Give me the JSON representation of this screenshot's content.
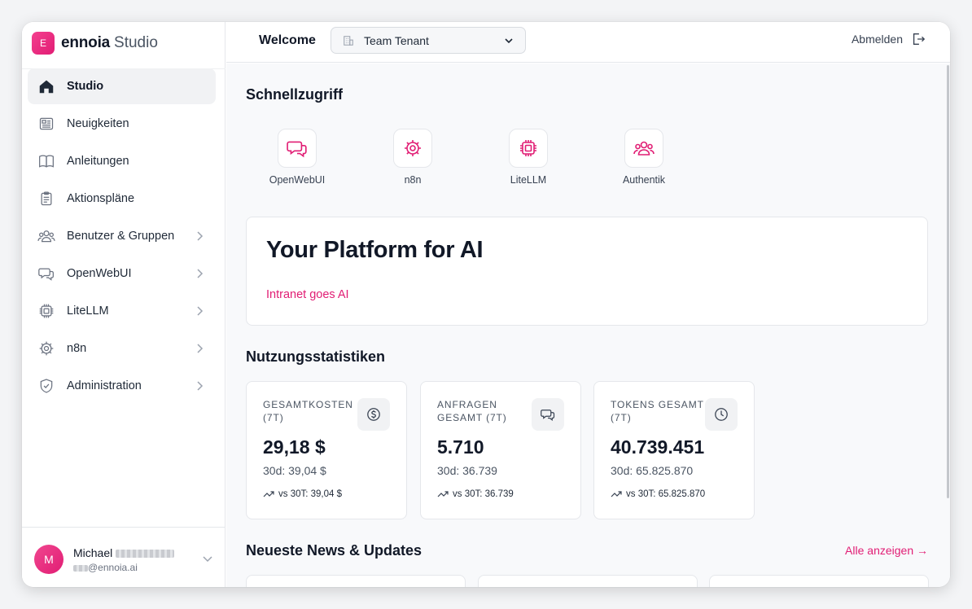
{
  "brand": {
    "badge": "E",
    "name": "ennoia",
    "suffix": "Studio",
    "accent": "#e11d74"
  },
  "sidebar": {
    "items": [
      {
        "label": "Studio",
        "icon": "home-icon",
        "active": true,
        "expandable": false
      },
      {
        "label": "Neuigkeiten",
        "icon": "newspaper-icon",
        "active": false,
        "expandable": false
      },
      {
        "label": "Anleitungen",
        "icon": "book-icon",
        "active": false,
        "expandable": false
      },
      {
        "label": "Aktionspläne",
        "icon": "clipboard-icon",
        "active": false,
        "expandable": false
      },
      {
        "label": "Benutzer & Gruppen",
        "icon": "users-icon",
        "active": false,
        "expandable": true
      },
      {
        "label": "OpenWebUI",
        "icon": "chat-icon",
        "active": false,
        "expandable": true
      },
      {
        "label": "LiteLLM",
        "icon": "chip-icon",
        "active": false,
        "expandable": true
      },
      {
        "label": "n8n",
        "icon": "cog-icon",
        "active": false,
        "expandable": true
      },
      {
        "label": "Administration",
        "icon": "shield-icon",
        "active": false,
        "expandable": true
      }
    ]
  },
  "user": {
    "initial": "M",
    "name": "Michael",
    "email": "@ennoia.ai"
  },
  "topbar": {
    "welcome": "Welcome",
    "tenant": "Team Tenant",
    "logout": "Abmelden"
  },
  "quick_access": {
    "title": "Schnellzugriff",
    "items": [
      {
        "label": "OpenWebUI",
        "icon": "chat-icon"
      },
      {
        "label": "n8n",
        "icon": "cog-icon"
      },
      {
        "label": "LiteLLM",
        "icon": "chip-icon"
      },
      {
        "label": "Authentik",
        "icon": "users-icon"
      }
    ]
  },
  "hero": {
    "title": "Your Platform for AI",
    "subtitle": "Intranet goes AI"
  },
  "stats": {
    "title": "Nutzungsstatistiken",
    "cards": [
      {
        "label": "GESAMTKOSTEN (7T)",
        "icon": "dollar-icon",
        "value": "29,18 $",
        "d30": "30d: 39,04 $",
        "vs": "vs 30T: 39,04 $"
      },
      {
        "label": "ANFRAGEN GESAMT (7T)",
        "icon": "chat-icon",
        "value": "5.710",
        "d30": "30d: 36.739",
        "vs": "vs 30T: 36.739"
      },
      {
        "label": "TOKENS GESAMT (7T)",
        "icon": "clock-icon",
        "value": "40.739.451",
        "d30": "30d: 65.825.870",
        "vs": "vs 30T: 65.825.870"
      }
    ]
  },
  "news": {
    "title": "Neueste News & Updates",
    "view_all": "Alle anzeigen →"
  }
}
